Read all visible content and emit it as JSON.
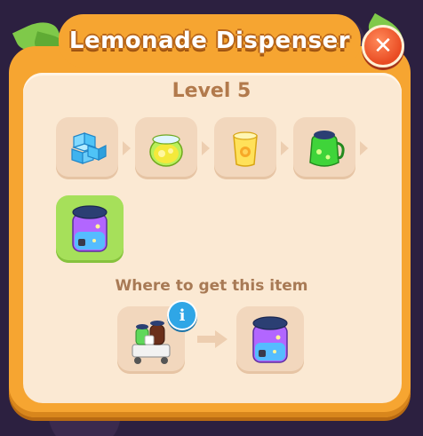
{
  "dialog": {
    "title": "Lemonade Dispenser",
    "close_glyph": "✕",
    "level_label": "Level 5"
  },
  "chain": {
    "items": [
      {
        "name": "ice-cubes-icon"
      },
      {
        "name": "lemon-jar-icon"
      },
      {
        "name": "lemonade-glass-icon"
      },
      {
        "name": "lemonade-pitcher-icon"
      },
      {
        "name": "lemonade-dispenser-icon",
        "current": true
      }
    ]
  },
  "source": {
    "label": "Where to get this item",
    "info_glyph": "i",
    "from_item": "drinks-cart-icon",
    "to_item": "lemonade-dispenser-icon"
  },
  "colors": {
    "panel": "#f6a531",
    "panel_inner": "#fbe9d3",
    "slot": "#f2d7bd",
    "slot_highlight": "#a6e05a",
    "close": "#e94b22",
    "info": "#2fa6e6"
  }
}
